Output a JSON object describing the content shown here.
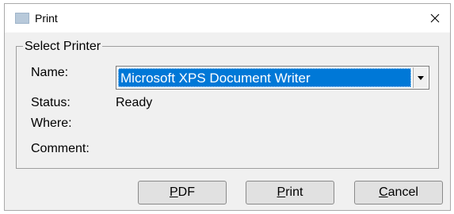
{
  "window": {
    "title": "Print"
  },
  "group": {
    "legend": "Select Printer"
  },
  "fields": {
    "name_label": "Name:",
    "name_value": "Microsoft XPS Document Writer",
    "status_label": "Status:",
    "status_value": "Ready",
    "where_label": "Where:",
    "comment_label": "Comment:"
  },
  "buttons": {
    "pdf": {
      "mnemonic": "P",
      "rest": "DF"
    },
    "print": {
      "mnemonic": "P",
      "rest": "rint"
    },
    "cancel": {
      "mnemonic": "C",
      "rest": "ancel"
    }
  },
  "icons": {
    "window": "printer-window-icon",
    "close": "close-icon",
    "dropdown": "chevron-down-icon"
  },
  "colors": {
    "selection": "#0078d7",
    "dialog_bg": "#f0f0f0"
  }
}
